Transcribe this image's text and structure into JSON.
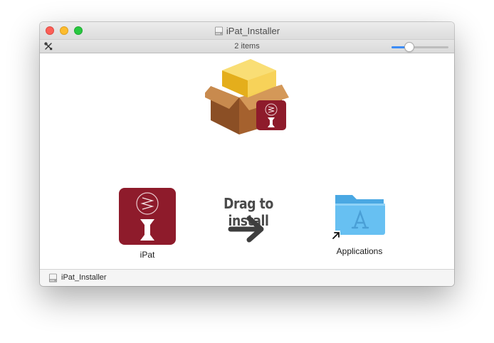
{
  "window": {
    "title": "iPat_Installer",
    "title_icon": "disk-image-icon",
    "traffic_lights": {
      "close": "#fc5f57",
      "minimize": "#fdbc2e",
      "zoom": "#28c840"
    }
  },
  "statusbar": {
    "item_count": "2 items",
    "tools_icon": "tools-icon",
    "icon_size_slider": {
      "value": 0.3
    }
  },
  "content": {
    "background_art": "package-box-icon",
    "instruction": "Drag to install",
    "arrow_icon": "right-arrow-icon",
    "items": [
      {
        "label": "iPat",
        "icon": "ipat-app-icon"
      },
      {
        "label": "Applications",
        "icon": "applications-folder-icon",
        "alias": true
      }
    ]
  },
  "pathbar": {
    "path": "iPat_Installer",
    "icon": "disk-image-icon"
  },
  "colors": {
    "ipat_brand": "#8e1b2b",
    "folder_blue": "#5cb8ef",
    "slider_accent": "#3c8cf6"
  }
}
